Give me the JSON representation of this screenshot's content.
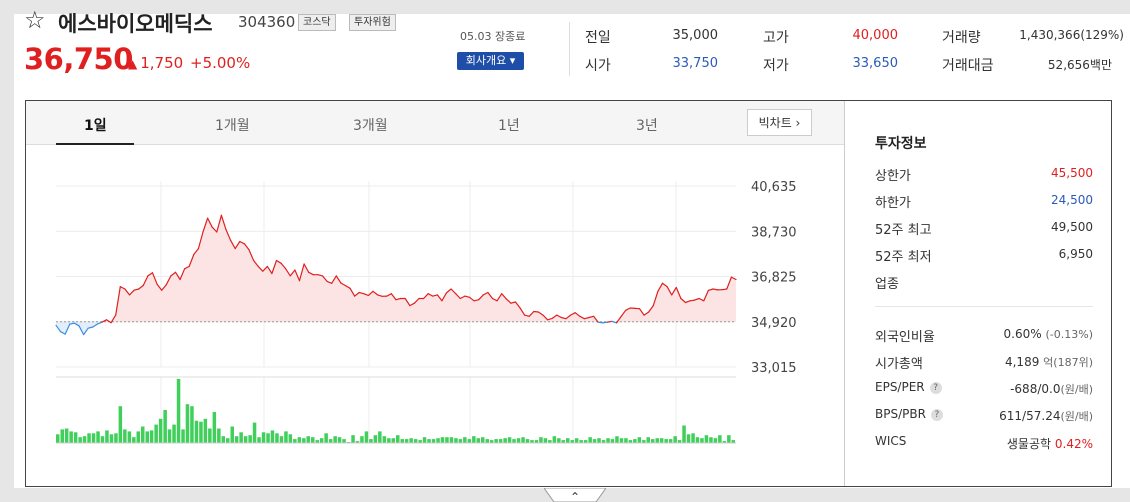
{
  "header": {
    "name": "에스바이오메딕스",
    "code": "304360",
    "badges": [
      "코스닥",
      "투자위험"
    ],
    "price": "36,750",
    "change_arrow": "▲",
    "change": "1,750",
    "change_pct": "+5.00%",
    "status": "05.03 장종료",
    "company_btn": "회사개요 ▾"
  },
  "quote": {
    "prev_label": "전일",
    "prev": "35,000",
    "open_label": "시가",
    "open": "33,750",
    "high_label": "고가",
    "high": "40,000",
    "low_label": "저가",
    "low": "33,650",
    "volume_label": "거래량",
    "volume": "1,430,366(129%)",
    "amount_label": "거래대금",
    "amount": "52,656백만"
  },
  "tabs": [
    "1일",
    "1개월",
    "3개월",
    "1년",
    "3년"
  ],
  "bigchart_label": "빅차트 ›",
  "colors": {
    "up": "#e02020",
    "down": "#2a5bb8",
    "fill": "#fde4e4",
    "volume": "#3fcf5a"
  },
  "chart_data": {
    "type": "line",
    "y_ticks": [
      "40,635",
      "38,730",
      "36,825",
      "34,920",
      "33,015"
    ],
    "ylim": [
      33015,
      40635
    ],
    "base": 34920,
    "x_ticks": [
      "10",
      "11",
      "12",
      "13",
      "14",
      "15"
    ],
    "price": [
      34770,
      34500,
      34400,
      34820,
      34860,
      34750,
      34380,
      34650,
      34700,
      34820,
      34900,
      35000,
      34880,
      35200,
      36400,
      36300,
      36050,
      36250,
      36300,
      36450,
      36850,
      36980,
      36500,
      36250,
      36480,
      36850,
      37000,
      36700,
      37150,
      37250,
      37750,
      38000,
      38700,
      39280,
      38900,
      38700,
      39400,
      38800,
      38350,
      38000,
      38300,
      38200,
      37950,
      37500,
      37250,
      37050,
      37250,
      36950,
      37500,
      37380,
      37150,
      36850,
      37100,
      36650,
      37350,
      37000,
      36900,
      36900,
      36850,
      36620,
      36540,
      36850,
      36550,
      36440,
      36330,
      36000,
      36150,
      36100,
      36030,
      36200,
      36050,
      35990,
      36000,
      36100,
      35850,
      35900,
      35900,
      35600,
      35700,
      35900,
      35900,
      36100,
      36000,
      36050,
      35800,
      36140,
      36300,
      36100,
      35900,
      36000,
      35950,
      35800,
      35850,
      36050,
      36150,
      35900,
      35800,
      36100,
      35880,
      35700,
      35750,
      35500,
      35200,
      35150,
      35350,
      35330,
      35200,
      35000,
      35060,
      35200,
      35100,
      35050,
      35200,
      35300,
      35150,
      35050,
      35100,
      35150,
      34900,
      34870,
      34900,
      34940,
      34870,
      35140,
      35400,
      35500,
      35480,
      35470,
      35200,
      35330,
      35600,
      36200,
      36540,
      36400,
      36050,
      36360,
      35900,
      35730,
      35800,
      35830,
      35900,
      35800,
      36240,
      36300,
      36260,
      36270,
      36300,
      36800,
      36700
    ],
    "volume": [
      9,
      14,
      15,
      12,
      11,
      6,
      7,
      10,
      10,
      12,
      7,
      13,
      9,
      10,
      38,
      14,
      12,
      6,
      12,
      17,
      12,
      13,
      19,
      25,
      34,
      14,
      19,
      66,
      14,
      40,
      38,
      23,
      22,
      25,
      15,
      32,
      15,
      7,
      5,
      17,
      7,
      11,
      7,
      8,
      21,
      6,
      11,
      10,
      13,
      10,
      7,
      12,
      9,
      4,
      6,
      5,
      7,
      6,
      3,
      5,
      10,
      4,
      7,
      6,
      4,
      1,
      8,
      2,
      7,
      12,
      4,
      8,
      12,
      7,
      5,
      5,
      8,
      4,
      4,
      5,
      4,
      3,
      6,
      4,
      4,
      5,
      6,
      6,
      6,
      5,
      4,
      6,
      4,
      7,
      5,
      6,
      4,
      3,
      4,
      4,
      5,
      6,
      4,
      5,
      6,
      4,
      3,
      3,
      6,
      5,
      3,
      7,
      5,
      3,
      5,
      3,
      5,
      3,
      3,
      6,
      4,
      5,
      3,
      5,
      4,
      7,
      5,
      5,
      3,
      4,
      6,
      3,
      6,
      4,
      5,
      5,
      4,
      4,
      7,
      3,
      18,
      9,
      10,
      6,
      5,
      8,
      6,
      5,
      8,
      2,
      8,
      3
    ]
  },
  "invest_info": {
    "title": "투자정보",
    "rows1": [
      {
        "label": "상한가",
        "value": "45,500",
        "color": "#e02020"
      },
      {
        "label": "하한가",
        "value": "24,500",
        "color": "#2a5bb8"
      },
      {
        "label": "52주 최고",
        "value": "49,500",
        "color": "#333333"
      },
      {
        "label": "52주 최저",
        "value": "6,950",
        "color": "#333333"
      },
      {
        "label": "업종",
        "value": "",
        "color": "#333333"
      }
    ],
    "foreign_label": "외국인비율",
    "foreign_value": "0.60%",
    "foreign_sub": "(-0.13%)",
    "mcap_label": "시가총액",
    "mcap_value": "4,189",
    "mcap_unit": "억",
    "mcap_sub": "(187위)",
    "eps_label": "EPS/PER",
    "eps_value": "-688/0.0",
    "eps_sub": "(원/배)",
    "bps_label": "BPS/PBR",
    "bps_value": "611/57.24",
    "bps_sub": "(원/배)",
    "qmark": "?",
    "wics_label": "WICS",
    "wics_value": "생물공학",
    "wics_pct": "0.42%"
  },
  "scroll_caret": "⌃"
}
